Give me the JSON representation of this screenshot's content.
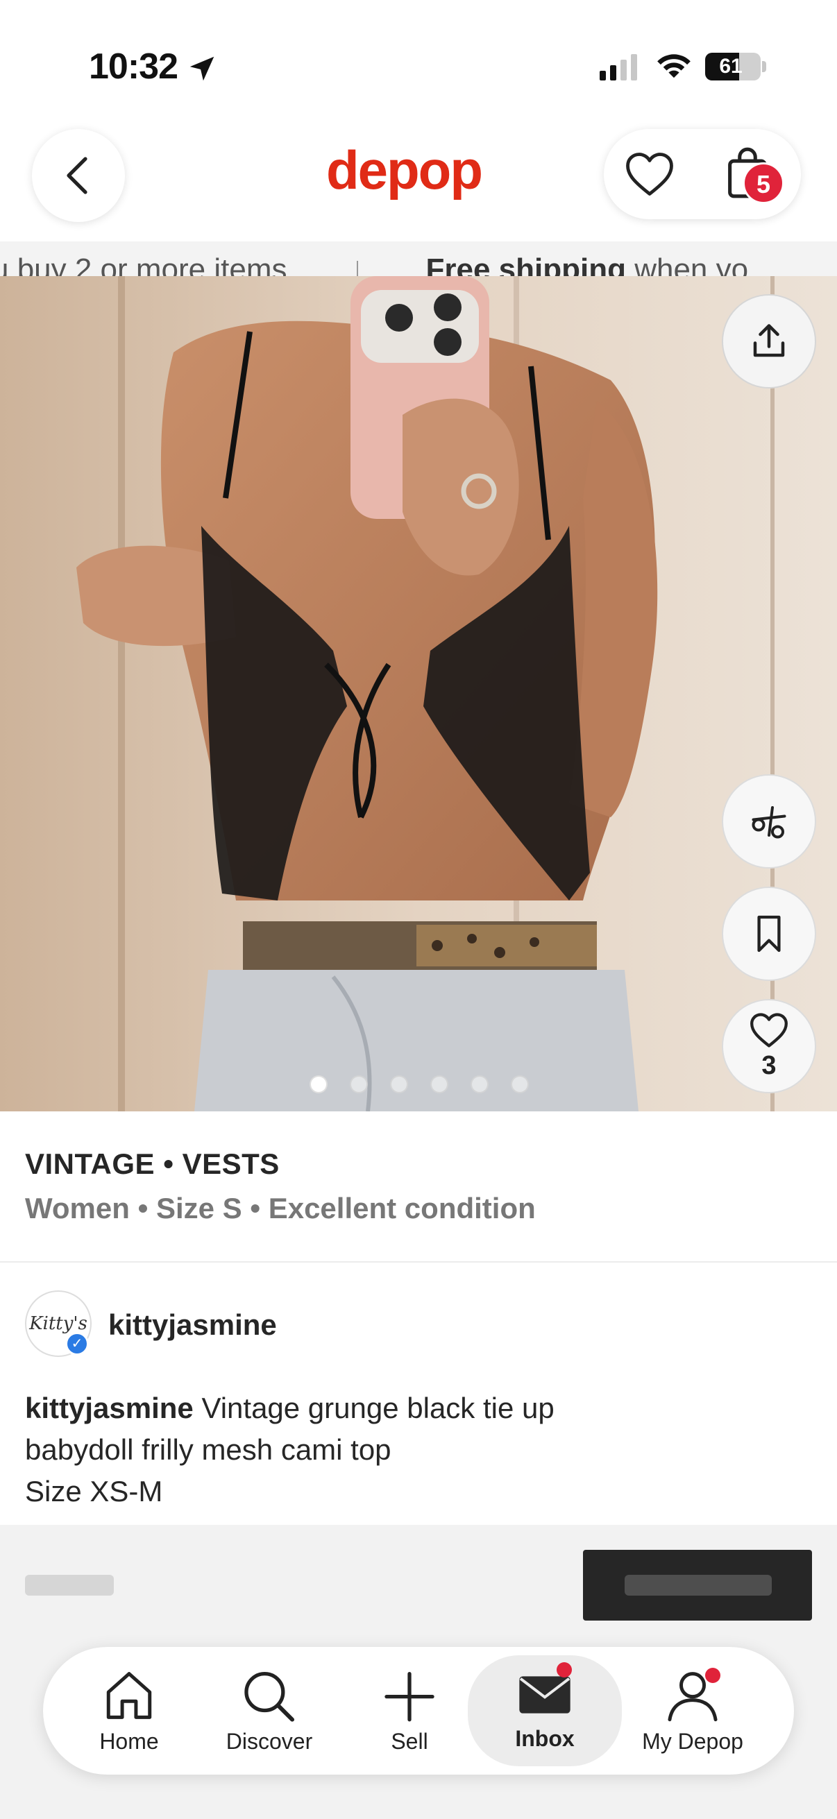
{
  "status_bar": {
    "time": "10:32",
    "battery_level": "61"
  },
  "header": {
    "logo": "depop",
    "cart_count": "5"
  },
  "promo": {
    "left_text": "u buy 2 or more items",
    "right_bold": "Free shipping",
    "right_text": " when yo"
  },
  "product": {
    "image_count": 6,
    "active_image": 1,
    "like_count": "3"
  },
  "listing": {
    "category": "VINTAGE • VESTS",
    "attributes": "Women • Size S • Excellent condition",
    "seller": "kittyjasmine",
    "avatar_text": "Kitty's",
    "description_user": "kittyjasmine",
    "description_line1": " Vintage grunge black tie up",
    "description_line2": "babydoll frilly mesh cami top",
    "description_line3": "Size XS-M"
  },
  "tab_bar": {
    "home": "Home",
    "discover": "Discover",
    "sell": "Sell",
    "inbox": "Inbox",
    "my_depop": "My Depop"
  },
  "colors": {
    "brand": "#e02b16",
    "badge": "#e0233a",
    "buy_button": "#262626"
  }
}
